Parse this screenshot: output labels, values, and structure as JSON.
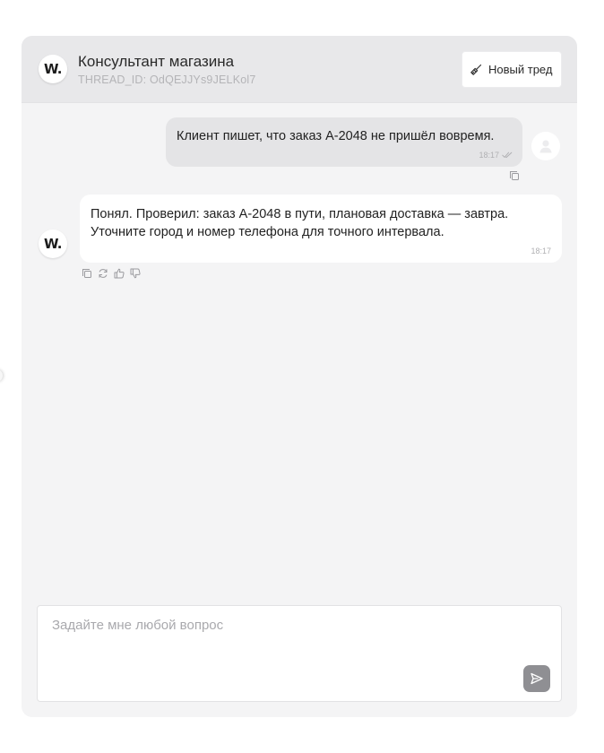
{
  "header": {
    "logo_text": "W.",
    "title": "Консультант магазина",
    "thread_id": "THREAD_ID: OdQEJJYs9JELKol7",
    "new_thread_label": "Новый тред"
  },
  "messages": [
    {
      "role": "user",
      "text": "Клиент пишет, что заказ А-2048 не пришёл вовремя.",
      "time": "18:17"
    },
    {
      "role": "assistant",
      "text": "Понял. Проверил: заказ А-2048 в пути, плановая доставка — завтра. Уточните город и номер телефона для точного интервала.",
      "time": "18:17",
      "avatar_text": "W."
    }
  ],
  "composer": {
    "placeholder": "Задайте мне любой вопрос",
    "value": ""
  },
  "icons": {
    "new_thread": "broom-icon",
    "read_status": "double-check-icon",
    "copy": "copy-icon",
    "regenerate": "refresh-icon",
    "like": "thumbs-up-icon",
    "dislike": "thumbs-down-icon",
    "send": "send-icon",
    "user_avatar": "user-icon"
  },
  "colors": {
    "panel_bg": "#f4f4f5",
    "header_bg": "#e8e8ea",
    "user_bubble": "#e4e4e6",
    "bot_bubble": "#ffffff",
    "send_button": "#8f8f93"
  }
}
